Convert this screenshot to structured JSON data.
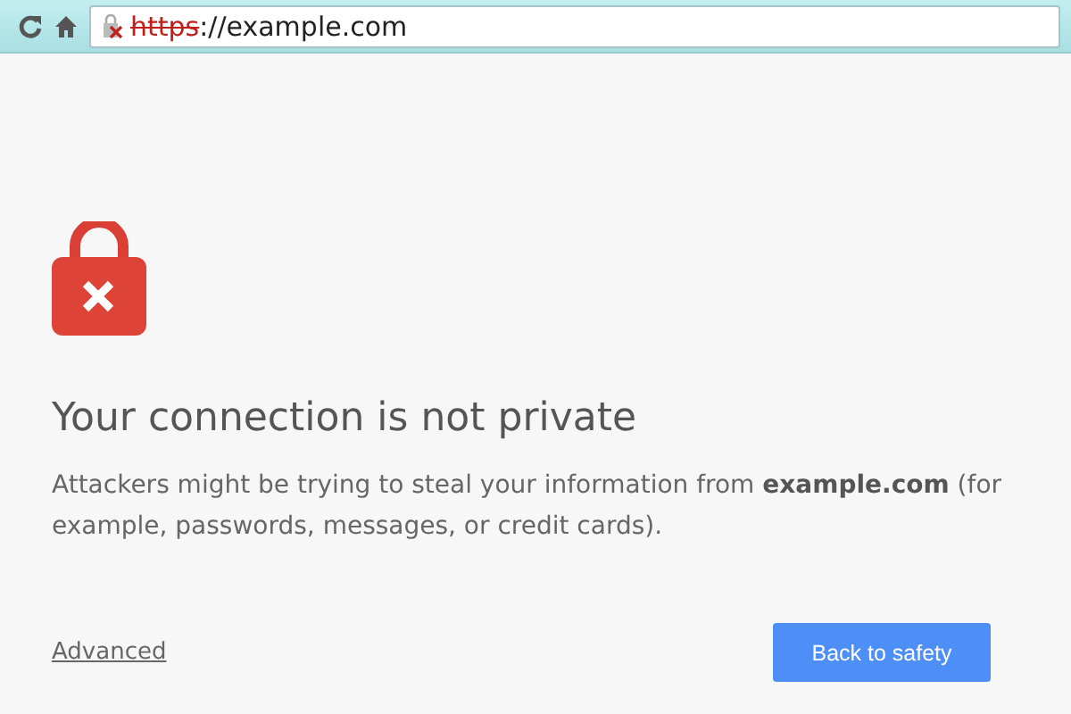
{
  "toolbar": {
    "address": {
      "scheme": "https",
      "rest": "://example.com",
      "insecure": true
    }
  },
  "page": {
    "title": "Your connection is not private",
    "message": "Attackers might be trying to steal your information from **example.com** (for example, passwords, messages, or credit cards).",
    "advanced_link": "Advanced",
    "primary_button": "Back to safety"
  }
}
